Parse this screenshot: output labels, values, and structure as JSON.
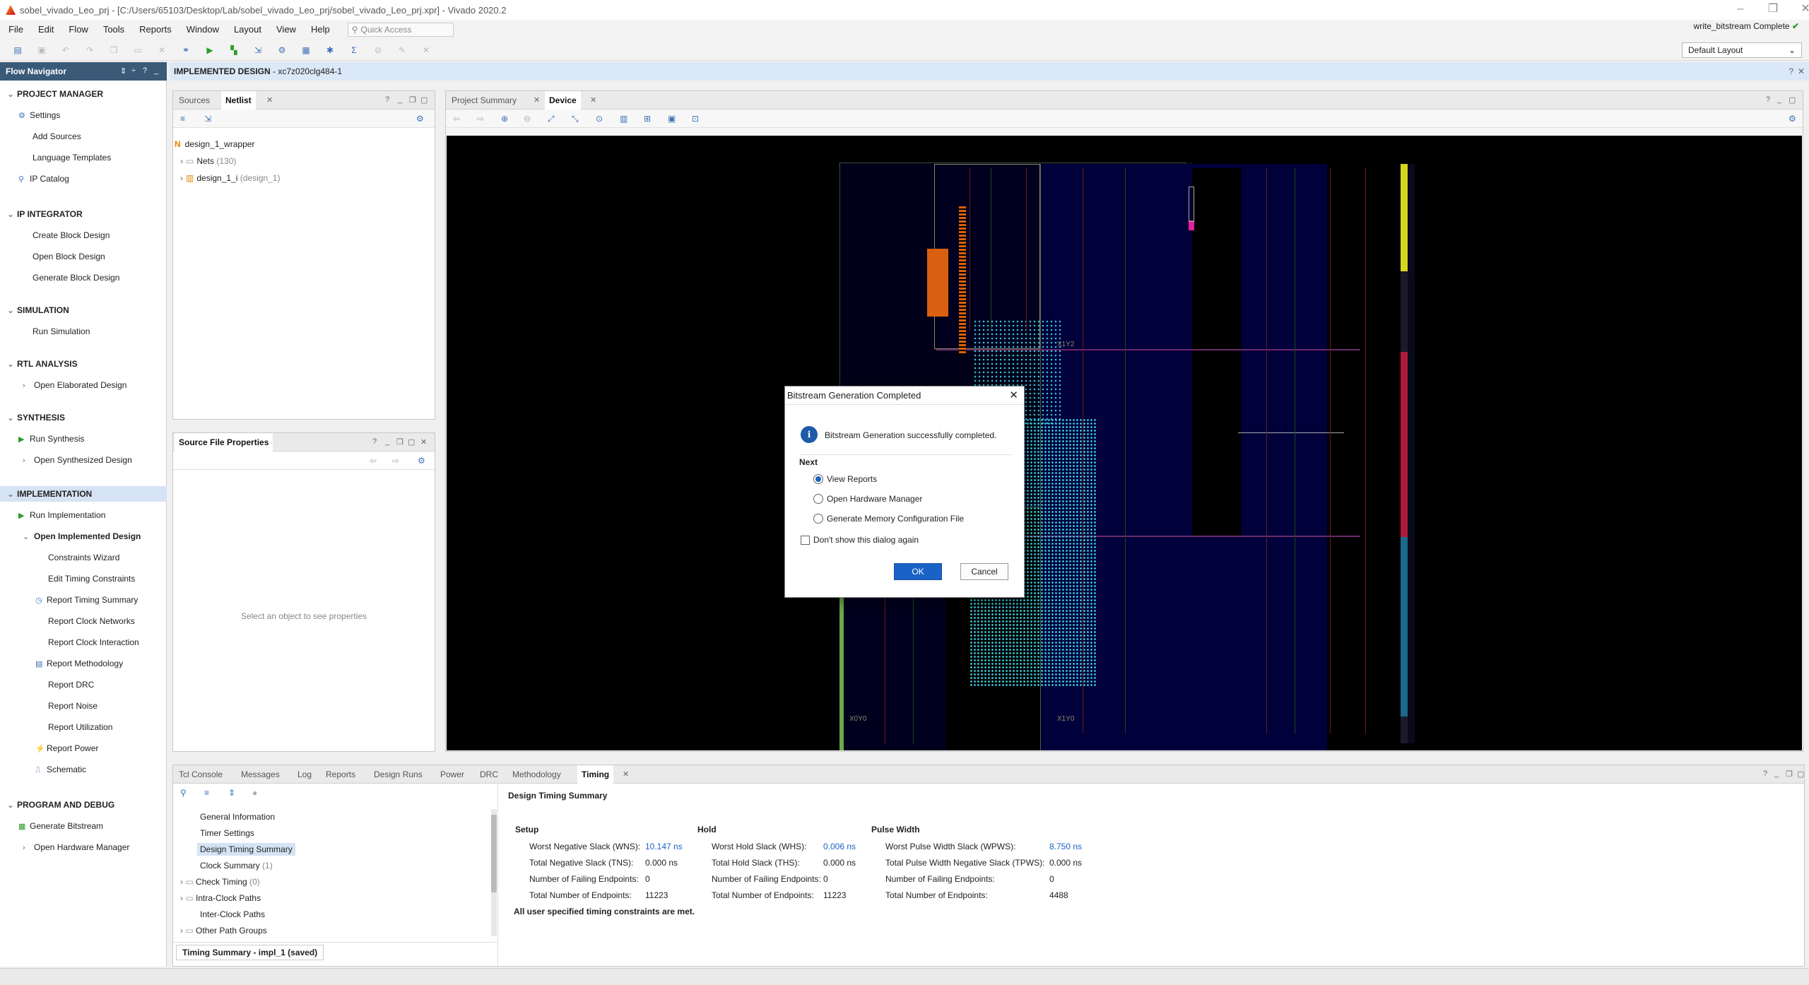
{
  "window": {
    "title": "sobel_vivado_Leo_prj - [C:/Users/65103/Desktop/Lab/sobel_vivado_Leo_prj/sobel_vivado_Leo_prj.xpr] - Vivado 2020.2"
  },
  "menu": {
    "items": [
      "File",
      "Edit",
      "Flow",
      "Tools",
      "Reports",
      "Window",
      "Layout",
      "View",
      "Help"
    ],
    "quick_access": "Quick Access"
  },
  "status": {
    "text": "write_bitstream Complete"
  },
  "layout": {
    "selected": "Default Layout"
  },
  "flow_navigator": {
    "title": "Flow Navigator",
    "project_manager": {
      "title": "PROJECT MANAGER",
      "settings": "Settings",
      "add_sources": "Add Sources",
      "language_templates": "Language Templates",
      "ip_catalog": "IP Catalog"
    },
    "ip_integrator": {
      "title": "IP INTEGRATOR",
      "create": "Create Block Design",
      "open": "Open Block Design",
      "generate": "Generate Block Design"
    },
    "simulation": {
      "title": "SIMULATION",
      "run": "Run Simulation"
    },
    "rtl": {
      "title": "RTL ANALYSIS",
      "open": "Open Elaborated Design"
    },
    "synthesis": {
      "title": "SYNTHESIS",
      "run": "Run Synthesis",
      "open": "Open Synthesized Design"
    },
    "implementation": {
      "title": "IMPLEMENTATION",
      "run": "Run Implementation",
      "open": "Open Implemented Design",
      "constraints_wizard": "Constraints Wizard",
      "edit_timing": "Edit Timing Constraints",
      "report_timing": "Report Timing Summary",
      "report_clock_networks": "Report Clock Networks",
      "report_clock_interaction": "Report Clock Interaction",
      "report_methodology": "Report Methodology",
      "report_drc": "Report DRC",
      "report_noise": "Report Noise",
      "report_utilization": "Report Utilization",
      "report_power": "Report Power",
      "schematic": "Schematic"
    },
    "program": {
      "title": "PROGRAM AND DEBUG",
      "generate_bitstream": "Generate Bitstream",
      "open_hw": "Open Hardware Manager"
    }
  },
  "design_header": {
    "label": "IMPLEMENTED DESIGN",
    "part": " - xc7z020clg484-1"
  },
  "netlist_panel": {
    "tabs": [
      "Sources",
      "Netlist"
    ],
    "root": "design_1_wrapper",
    "nets": "Nets",
    "nets_count": "(130)",
    "inst": "design_1_i",
    "inst_type": "(design_1)"
  },
  "props_panel": {
    "title": "Source File Properties",
    "empty": "Select an object to see properties"
  },
  "device_panel": {
    "tabs": [
      "Project Summary",
      "Device"
    ],
    "clock_regions": [
      "X1Y2",
      "X1Y0",
      "X0Y0"
    ]
  },
  "dialog": {
    "title": "Bitstream Generation Completed",
    "message": "Bitstream Generation successfully completed.",
    "next_label": "Next",
    "options": [
      "View Reports",
      "Open Hardware Manager",
      "Generate Memory Configuration File"
    ],
    "selected": "View Reports",
    "dont_show": "Don't show this dialog again",
    "ok": "OK",
    "cancel": "Cancel"
  },
  "bottom_panel": {
    "tabs": [
      "Tcl Console",
      "Messages",
      "Log",
      "Reports",
      "Design Runs",
      "Power",
      "DRC",
      "Methodology",
      "Timing"
    ],
    "tree": [
      {
        "label": "General Information"
      },
      {
        "label": "Timer Settings"
      },
      {
        "label": "Design Timing Summary"
      },
      {
        "label": "Clock Summary",
        "count": "(1)"
      },
      {
        "label": "Check Timing",
        "count": "(0)"
      },
      {
        "label": "Intra-Clock Paths"
      },
      {
        "label": "Inter-Clock Paths"
      },
      {
        "label": "Other Path Groups"
      }
    ],
    "footer": "Timing Summary - impl_1 (saved)",
    "summary_title": "Design Timing Summary",
    "setup": {
      "title": "Setup",
      "wns_l": "Worst Negative Slack (WNS):",
      "wns": "10.147 ns",
      "tns_l": "Total Negative Slack (TNS):",
      "tns": "0.000 ns",
      "fail_l": "Number of Failing Endpoints:",
      "fail": "0",
      "total_l": "Total Number of Endpoints:",
      "total": "11223"
    },
    "hold": {
      "title": "Hold",
      "whs_l": "Worst Hold Slack (WHS):",
      "whs": "0.006 ns",
      "ths_l": "Total Hold Slack (THS):",
      "ths": "0.000 ns",
      "fail_l": "Number of Failing Endpoints:",
      "fail": "0",
      "total_l": "Total Number of Endpoints:",
      "total": "11223"
    },
    "pw": {
      "title": "Pulse Width",
      "wpws_l": "Worst Pulse Width Slack (WPWS):",
      "wpws": "8.750 ns",
      "tpws_l": "Total Pulse Width Negative Slack (TPWS):",
      "tpws": "0.000 ns",
      "fail_l": "Number of Failing Endpoints:",
      "fail": "0",
      "total_l": "Total Number of Endpoints:",
      "total": "4488"
    },
    "met": "All user specified timing constraints are met."
  },
  "colors": {
    "accent": "#1a62c6",
    "navigator_title": "#3a5a78",
    "device_bg": "#000000"
  }
}
